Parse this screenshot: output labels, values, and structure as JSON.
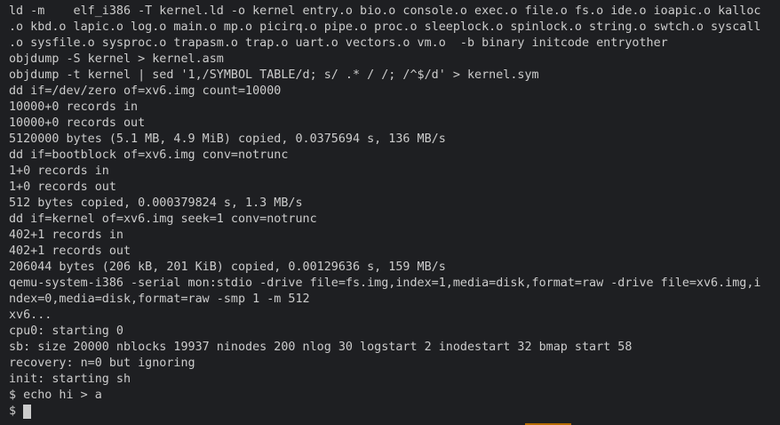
{
  "terminal": {
    "lines": [
      "ld -m    elf_i386 -T kernel.ld -o kernel entry.o bio.o console.o exec.o file.o fs.o ide.o ioapic.o kalloc",
      ".o kbd.o lapic.o log.o main.o mp.o picirq.o pipe.o proc.o sleeplock.o spinlock.o string.o swtch.o syscall",
      ".o sysfile.o sysproc.o trapasm.o trap.o uart.o vectors.o vm.o  -b binary initcode entryother",
      "objdump -S kernel > kernel.asm",
      "objdump -t kernel | sed '1,/SYMBOL TABLE/d; s/ .* / /; /^$/d' > kernel.sym",
      "dd if=/dev/zero of=xv6.img count=10000",
      "10000+0 records in",
      "10000+0 records out",
      "5120000 bytes (5.1 MB, 4.9 MiB) copied, 0.0375694 s, 136 MB/s",
      "dd if=bootblock of=xv6.img conv=notrunc",
      "1+0 records in",
      "1+0 records out",
      "512 bytes copied, 0.000379824 s, 1.3 MB/s",
      "dd if=kernel of=xv6.img seek=1 conv=notrunc",
      "402+1 records in",
      "402+1 records out",
      "206044 bytes (206 kB, 201 KiB) copied, 0.00129636 s, 159 MB/s",
      "qemu-system-i386 -serial mon:stdio -drive file=fs.img,index=1,media=disk,format=raw -drive file=xv6.img,i",
      "ndex=0,media=disk,format=raw -smp 1 -m 512",
      "xv6...",
      "cpu0: starting 0",
      "sb: size 20000 nblocks 19937 ninodes 200 nlog 30 logstart 2 inodestart 32 bmap start 58",
      "recovery: n=0 but ignoring",
      "init: starting sh",
      "$ echo hi > a"
    ],
    "prompt": "$",
    "colors": {
      "background": "#1e1f22",
      "foreground": "#cccccc",
      "cursor": "#cccccc",
      "accent": "#b36b00"
    }
  }
}
